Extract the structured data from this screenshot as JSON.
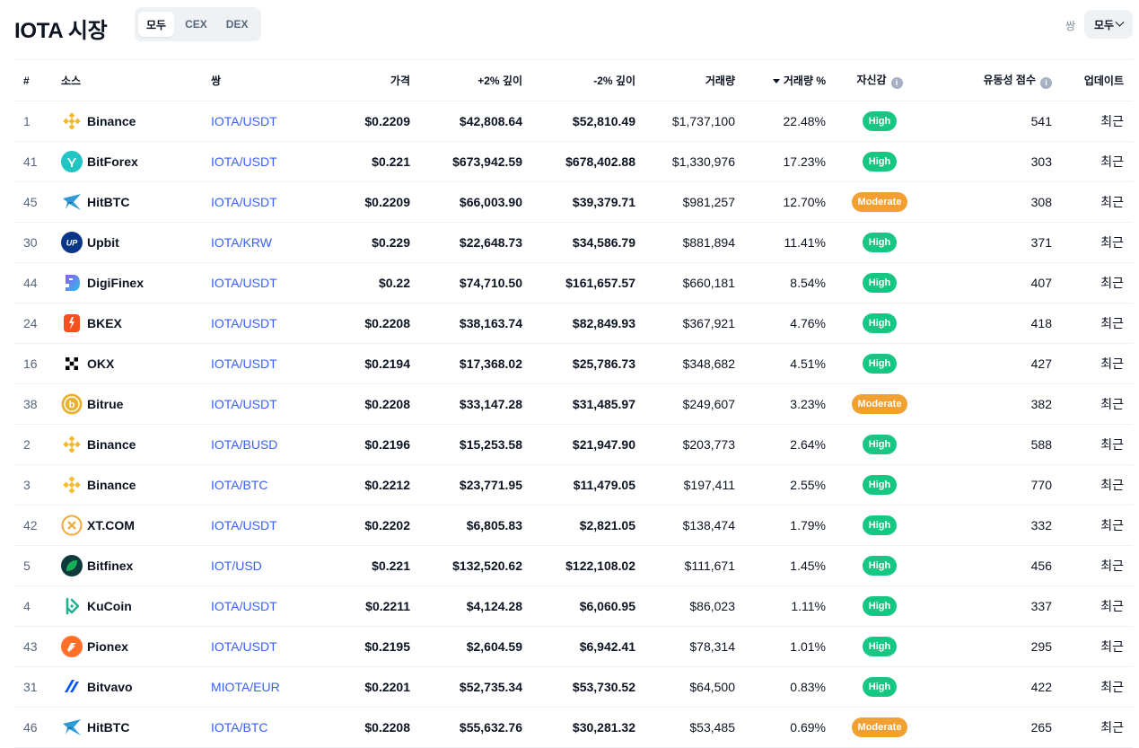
{
  "header": {
    "title": "IOTA 시장",
    "filters": [
      "모두",
      "CEX",
      "DEX"
    ],
    "active_filter": "모두",
    "pair_label": "쌍",
    "pair_select": "모두"
  },
  "columns": {
    "rank": "#",
    "source": "소스",
    "pair": "쌍",
    "price": "가격",
    "depth_plus": "+2% 깊이",
    "depth_minus": "-2% 깊이",
    "volume": "거래량",
    "volume_pct": "거래량 %",
    "confidence": "자신감",
    "liquidity": "유동성 점수",
    "updated": "업데이트"
  },
  "colors": {
    "high": "#16c784",
    "moderate": "#f3a033",
    "link": "#3861fb"
  },
  "rows": [
    {
      "rank": "1",
      "source": "Binance",
      "icon": "binance-logo",
      "pair": "IOTA/USDT",
      "price": "$0.2209",
      "depth_plus": "$42,808.64",
      "depth_minus": "$52,810.49",
      "volume": "$1,737,100",
      "volume_pct": "22.48%",
      "confidence": "High",
      "liquidity": "541",
      "updated": "최근"
    },
    {
      "rank": "41",
      "source": "BitForex",
      "icon": "bitforex-logo",
      "pair": "IOTA/USDT",
      "price": "$0.221",
      "depth_plus": "$673,942.59",
      "depth_minus": "$678,402.88",
      "volume": "$1,330,976",
      "volume_pct": "17.23%",
      "confidence": "High",
      "liquidity": "303",
      "updated": "최근"
    },
    {
      "rank": "45",
      "source": "HitBTC",
      "icon": "hitbtc-logo",
      "pair": "IOTA/USDT",
      "price": "$0.2209",
      "depth_plus": "$66,003.90",
      "depth_minus": "$39,379.71",
      "volume": "$981,257",
      "volume_pct": "12.70%",
      "confidence": "Moderate",
      "liquidity": "308",
      "updated": "최근"
    },
    {
      "rank": "30",
      "source": "Upbit",
      "icon": "upbit-logo",
      "pair": "IOTA/KRW",
      "price": "$0.229",
      "depth_plus": "$22,648.73",
      "depth_minus": "$34,586.79",
      "volume": "$881,894",
      "volume_pct": "11.41%",
      "confidence": "High",
      "liquidity": "371",
      "updated": "최근"
    },
    {
      "rank": "44",
      "source": "DigiFinex",
      "icon": "digifinex-logo",
      "pair": "IOTA/USDT",
      "price": "$0.22",
      "depth_plus": "$74,710.50",
      "depth_minus": "$161,657.57",
      "volume": "$660,181",
      "volume_pct": "8.54%",
      "confidence": "High",
      "liquidity": "407",
      "updated": "최근"
    },
    {
      "rank": "24",
      "source": "BKEX",
      "icon": "bkex-logo",
      "pair": "IOTA/USDT",
      "price": "$0.2208",
      "depth_plus": "$38,163.74",
      "depth_minus": "$82,849.93",
      "volume": "$367,921",
      "volume_pct": "4.76%",
      "confidence": "High",
      "liquidity": "418",
      "updated": "최근"
    },
    {
      "rank": "16",
      "source": "OKX",
      "icon": "okx-logo",
      "pair": "IOTA/USDT",
      "price": "$0.2194",
      "depth_plus": "$17,368.02",
      "depth_minus": "$25,786.73",
      "volume": "$348,682",
      "volume_pct": "4.51%",
      "confidence": "High",
      "liquidity": "427",
      "updated": "최근"
    },
    {
      "rank": "38",
      "source": "Bitrue",
      "icon": "bitrue-logo",
      "pair": "IOTA/USDT",
      "price": "$0.2208",
      "depth_plus": "$33,147.28",
      "depth_minus": "$31,485.97",
      "volume": "$249,607",
      "volume_pct": "3.23%",
      "confidence": "Moderate",
      "liquidity": "382",
      "updated": "최근"
    },
    {
      "rank": "2",
      "source": "Binance",
      "icon": "binance-logo",
      "pair": "IOTA/BUSD",
      "price": "$0.2196",
      "depth_plus": "$15,253.58",
      "depth_minus": "$21,947.90",
      "volume": "$203,773",
      "volume_pct": "2.64%",
      "confidence": "High",
      "liquidity": "588",
      "updated": "최근"
    },
    {
      "rank": "3",
      "source": "Binance",
      "icon": "binance-logo",
      "pair": "IOTA/BTC",
      "price": "$0.2212",
      "depth_plus": "$23,771.95",
      "depth_minus": "$11,479.05",
      "volume": "$197,411",
      "volume_pct": "2.55%",
      "confidence": "High",
      "liquidity": "770",
      "updated": "최근"
    },
    {
      "rank": "42",
      "source": "XT.COM",
      "icon": "xtcom-logo",
      "pair": "IOTA/USDT",
      "price": "$0.2202",
      "depth_plus": "$6,805.83",
      "depth_minus": "$2,821.05",
      "volume": "$138,474",
      "volume_pct": "1.79%",
      "confidence": "High",
      "liquidity": "332",
      "updated": "최근"
    },
    {
      "rank": "5",
      "source": "Bitfinex",
      "icon": "bitfinex-logo",
      "pair": "IOT/USD",
      "price": "$0.221",
      "depth_plus": "$132,520.62",
      "depth_minus": "$122,108.02",
      "volume": "$111,671",
      "volume_pct": "1.45%",
      "confidence": "High",
      "liquidity": "456",
      "updated": "최근"
    },
    {
      "rank": "4",
      "source": "KuCoin",
      "icon": "kucoin-logo",
      "pair": "IOTA/USDT",
      "price": "$0.2211",
      "depth_plus": "$4,124.28",
      "depth_minus": "$6,060.95",
      "volume": "$86,023",
      "volume_pct": "1.11%",
      "confidence": "High",
      "liquidity": "337",
      "updated": "최근"
    },
    {
      "rank": "43",
      "source": "Pionex",
      "icon": "pionex-logo",
      "pair": "IOTA/USDT",
      "price": "$0.2195",
      "depth_plus": "$2,604.59",
      "depth_minus": "$6,942.41",
      "volume": "$78,314",
      "volume_pct": "1.01%",
      "confidence": "High",
      "liquidity": "295",
      "updated": "최근"
    },
    {
      "rank": "31",
      "source": "Bitvavo",
      "icon": "bitvavo-logo",
      "pair": "MIOTA/EUR",
      "price": "$0.2201",
      "depth_plus": "$52,735.34",
      "depth_minus": "$53,730.52",
      "volume": "$64,500",
      "volume_pct": "0.83%",
      "confidence": "High",
      "liquidity": "422",
      "updated": "최근"
    },
    {
      "rank": "46",
      "source": "HitBTC",
      "icon": "hitbtc-logo",
      "pair": "IOTA/BTC",
      "price": "$0.2208",
      "depth_plus": "$55,632.76",
      "depth_minus": "$30,281.32",
      "volume": "$53,485",
      "volume_pct": "0.69%",
      "confidence": "Moderate",
      "liquidity": "265",
      "updated": "최근"
    }
  ]
}
